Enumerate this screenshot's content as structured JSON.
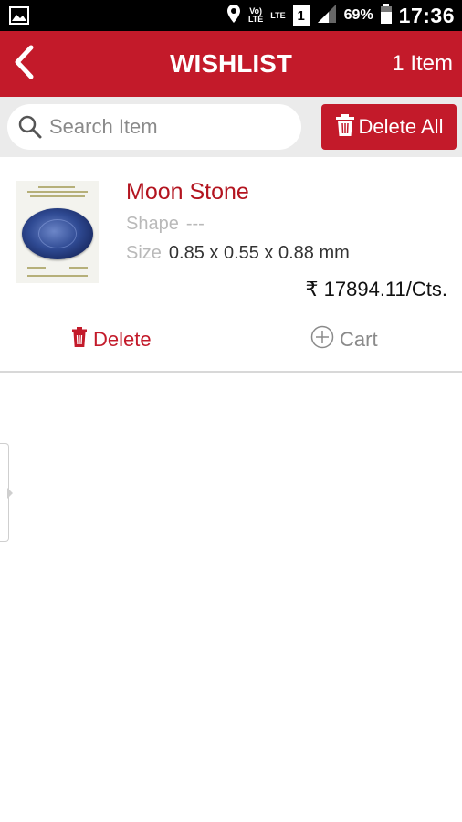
{
  "status_bar": {
    "network_label_top": "Vo)",
    "network_label_bottom": "LTE",
    "lte_label": "LTE",
    "sim_number": "1",
    "battery": "69%",
    "time": "17:36"
  },
  "header": {
    "title": "WISHLIST",
    "item_count": "1 Item"
  },
  "search": {
    "placeholder": "Search Item",
    "value": ""
  },
  "toolbar": {
    "delete_all_label": "Delete All"
  },
  "colors": {
    "accent": "#c31a2a",
    "product_name": "#b3141f",
    "muted": "#b9b9b9"
  },
  "items": [
    {
      "name": "Moon Stone",
      "shape_label": "Shape",
      "shape_value": "---",
      "size_label": "Size",
      "size_value": "0.85 x 0.55 x 0.88 mm",
      "price": "₹ 17894.11/Cts.",
      "delete_label": "Delete",
      "cart_label": "Cart"
    }
  ],
  "icons": {
    "back": "chevron-left-icon",
    "search": "search-icon",
    "trash": "trash-icon",
    "cart_add": "plus-circle-icon"
  }
}
